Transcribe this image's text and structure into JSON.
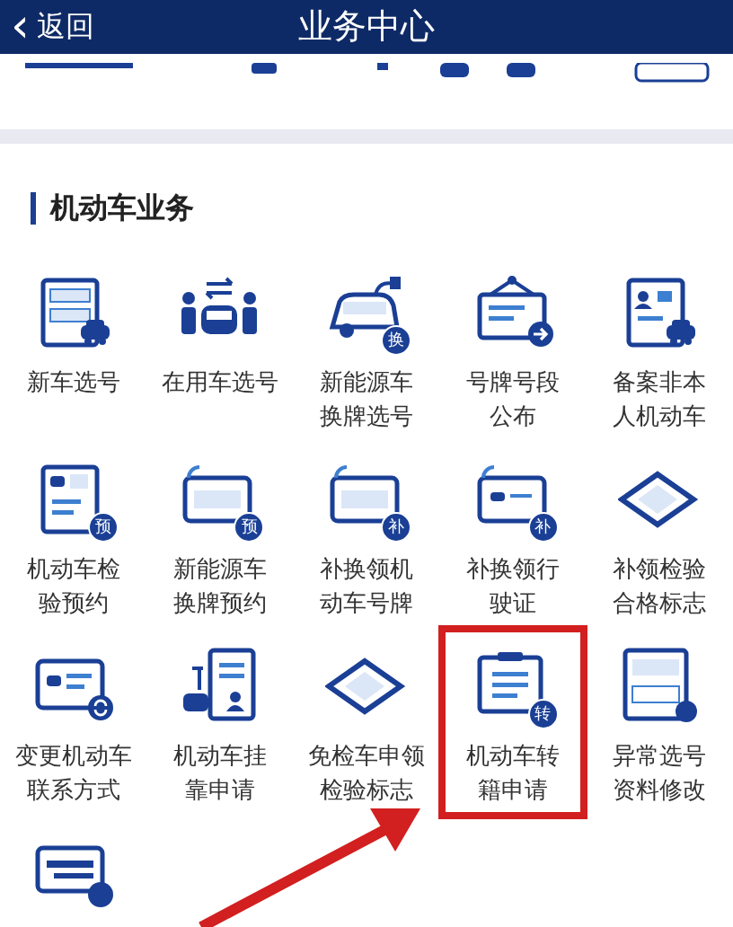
{
  "header": {
    "back": "返回",
    "back_arrow": "‹",
    "title": "业务中心"
  },
  "section": {
    "title": "机动车业务"
  },
  "items": [
    {
      "lines": [
        "新车选号"
      ],
      "highlighted": false
    },
    {
      "lines": [
        "在用车选号"
      ],
      "highlighted": false
    },
    {
      "lines": [
        "新能源车",
        "换牌选号"
      ],
      "badge": "换",
      "highlighted": false
    },
    {
      "lines": [
        "号牌号段",
        "公布"
      ],
      "highlighted": false
    },
    {
      "lines": [
        "备案非本",
        "人机动车"
      ],
      "highlighted": false
    },
    {
      "lines": [
        "机动车检",
        "验预约"
      ],
      "badge": "预",
      "highlighted": false
    },
    {
      "lines": [
        "新能源车",
        "换牌预约"
      ],
      "badge": "预",
      "highlighted": false
    },
    {
      "lines": [
        "补换领机",
        "动车号牌"
      ],
      "badge": "补",
      "highlighted": false
    },
    {
      "lines": [
        "补换领行",
        "驶证"
      ],
      "badge": "补",
      "highlighted": false
    },
    {
      "lines": [
        "补领检验",
        "合格标志"
      ],
      "highlighted": false
    },
    {
      "lines": [
        "变更机动车",
        "联系方式"
      ],
      "highlighted": false
    },
    {
      "lines": [
        "机动车挂",
        "靠申请"
      ],
      "highlighted": false
    },
    {
      "lines": [
        "免检车申领",
        "检验标志"
      ],
      "highlighted": false
    },
    {
      "lines": [
        "机动车转",
        "籍申请"
      ],
      "badge": "转",
      "highlighted": true
    },
    {
      "lines": [
        "异常选号",
        "资料修改"
      ],
      "highlighted": false
    },
    {
      "highlighted": false
    }
  ]
}
